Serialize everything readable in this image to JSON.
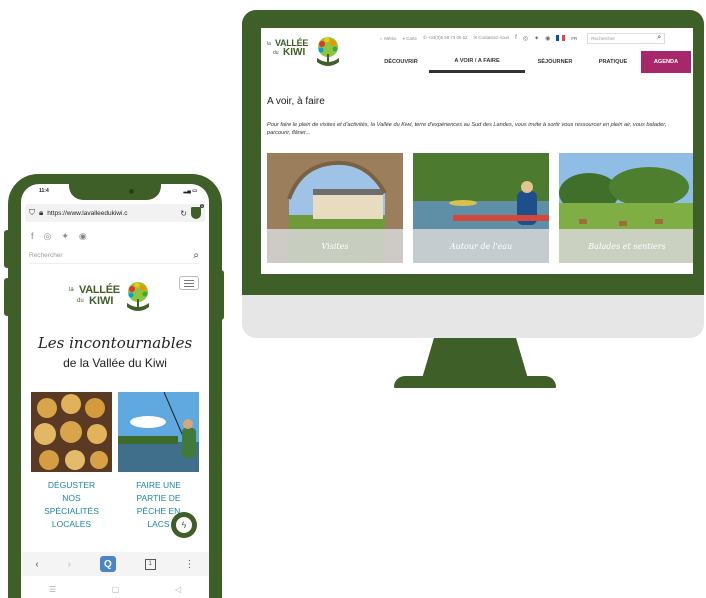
{
  "colors": {
    "brand_green": "#3f5f28",
    "agenda_magenta": "#a6286b",
    "link_blue": "#1f86a7"
  },
  "desktop": {
    "utility": {
      "weather": "Météo",
      "map": "Carte",
      "phone": "+33(0)5 58 73 00 52",
      "contact": "Contactez-nous",
      "lang": "FR",
      "search_placeholder": "Rechercher"
    },
    "logo": {
      "la": "la",
      "vallee": "VALLÉE",
      "du": "du",
      "kiwi": "KIWI"
    },
    "nav": [
      "DÉCOUVRIR",
      "A VOIR / A FAIRE",
      "SÉJOURNER",
      "PRATIQUE",
      "AGENDA"
    ],
    "heading": "A voir, à faire",
    "intro": "Pour faire le plein de visites et d'activités, la Vallée du Kiwi, terre d'expériences au Sud des Landes, vous invite à sortir vous ressourcer en plein air, vous balader, parcourir, flâner...",
    "cards": [
      "Visites",
      "Autour de l'eau",
      "Balades et sentiers"
    ]
  },
  "mobile": {
    "time": "11:4",
    "url": "https://www.lavalleedukiwi.c",
    "search_placeholder": "Rechercher",
    "logo": {
      "la": "la",
      "vallee": "VALLÉE",
      "du": "du",
      "kiwi": "KIWI"
    },
    "title": "Les incontournables",
    "subtitle": "de la Vallée du Kiwi",
    "cards": [
      "DÉGUSTER\nNOS\nSPÉCIALITÉS\nLOCALES",
      "FAIRE UNE\nPARTIE DE\nPÊCHE EN\nLACS"
    ],
    "nav": {
      "back": "‹",
      "forward": "›",
      "app": "Q",
      "tabs": "1",
      "more": "⋮"
    }
  }
}
